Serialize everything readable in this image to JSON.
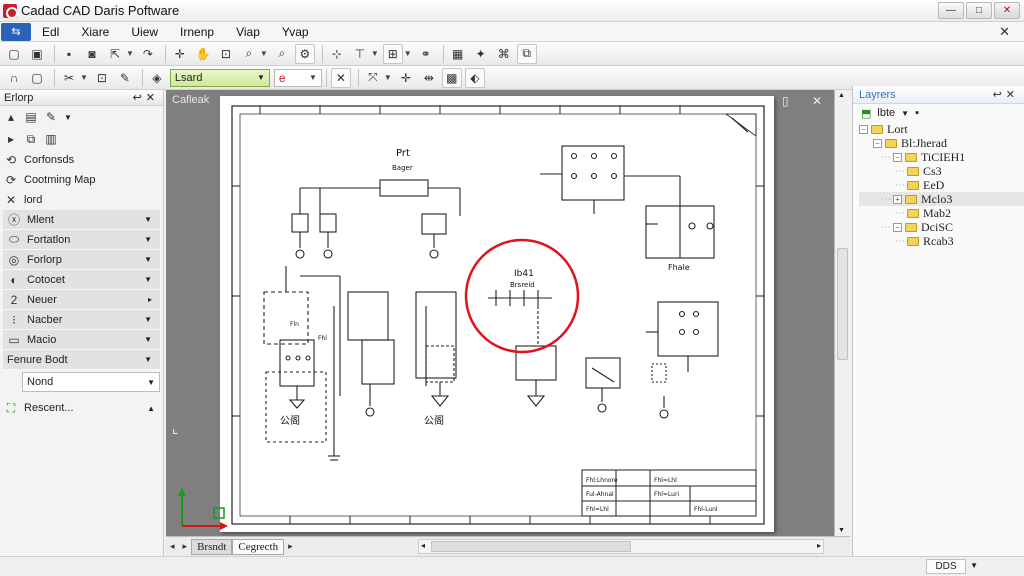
{
  "app": {
    "title": "Cadad CAD Daris Poftware",
    "window_buttons": [
      "—",
      "□",
      "✕"
    ]
  },
  "menu": {
    "app_button": "⇆",
    "items": [
      "Edl",
      "Xiare",
      "Uiew",
      "Irnenp",
      "Viap",
      "Yvap"
    ],
    "close_doc": "✕"
  },
  "toolbar2": {
    "layer_value": "Lsard",
    "color_value": "e"
  },
  "left_panel": {
    "title": "Erlorp",
    "rows": [
      {
        "label": "Corfonsds",
        "icon": "⟲",
        "arrow": ""
      },
      {
        "label": "Cootming Map",
        "icon": "⟳",
        "arrow": ""
      },
      {
        "label": "lord",
        "icon": "✕",
        "arrow": ""
      },
      {
        "label": "Mlent",
        "icon": "ⓧ",
        "arrow": "▼"
      },
      {
        "label": "Fortatlon",
        "icon": "⬭",
        "arrow": "▼"
      },
      {
        "label": "Forlorp",
        "icon": "◎",
        "arrow": "▼"
      },
      {
        "label": "Cotocet",
        "icon": "◐",
        "arrow": "▼"
      },
      {
        "label": "Neuer",
        "icon": "2",
        "arrow": "▸"
      },
      {
        "label": "Nacber",
        "icon": "⁝",
        "arrow": "▼"
      },
      {
        "label": "Macio",
        "icon": "▭",
        "arrow": "▼"
      },
      {
        "label": "Fenure Bodt",
        "icon": "",
        "arrow": "▼"
      }
    ],
    "combo_value": "Nond",
    "footer_label": "Rescent..."
  },
  "workspace": {
    "title": "Cafleak",
    "buttons": "▯ ✕",
    "tabs": [
      "Brsndt",
      "Cegrecth"
    ],
    "nav": [
      "◂",
      "▸"
    ]
  },
  "drawing": {
    "labels": {
      "pt": "Prt",
      "sub": "Bager",
      "rellay": "Fhale",
      "circle_top": "Ib41",
      "circle_sub": "Brsreid",
      "left_part": "公阁",
      "mid_part": "公阁",
      "small_a": "Fln",
      "small_b": "Fhl",
      "tb_a": "Fhl:Lhnore",
      "tb_b": "Fhl=Lhl",
      "tb_c": "Ful-Ahnal",
      "tb_d": "Fhl=Luri",
      "tb_e": "Fhl=Lhl",
      "tb_f": "Fhl-Lunl"
    },
    "accent_red": "#e0141e"
  },
  "right_panel": {
    "title": "Layrers",
    "toolbar_label": "lbte",
    "tree": [
      {
        "label": "Lort",
        "depth": 0,
        "exp": "−"
      },
      {
        "label": "Bl:Jherad",
        "depth": 1,
        "exp": "−"
      },
      {
        "label": "TiCIEH1",
        "depth": 2,
        "exp": "−"
      },
      {
        "label": "Cs3",
        "depth": 3,
        "exp": ""
      },
      {
        "label": "EeD",
        "depth": 3,
        "exp": ""
      },
      {
        "label": "Mclo3",
        "depth": 2,
        "exp": "+",
        "selected": true
      },
      {
        "label": "Mab2",
        "depth": 3,
        "exp": ""
      },
      {
        "label": "DciSC",
        "depth": 2,
        "exp": "−"
      },
      {
        "label": "Rcab3",
        "depth": 3,
        "exp": ""
      }
    ]
  },
  "status": {
    "zoom": "DDS"
  }
}
